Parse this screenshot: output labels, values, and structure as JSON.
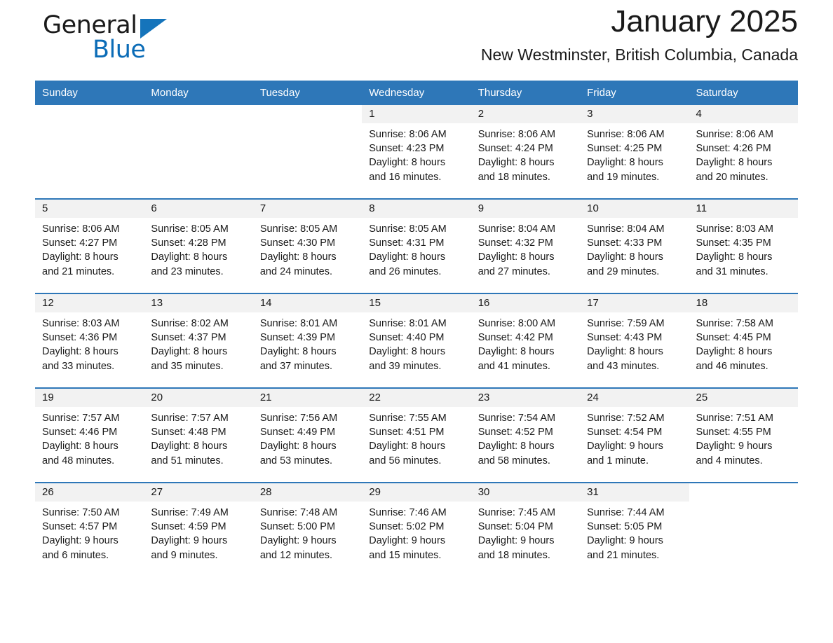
{
  "brand": {
    "word1": "General",
    "word2": "Blue",
    "accent_color": "#0b6cb7",
    "triangle_color": "#1574bb"
  },
  "header": {
    "month_title": "January 2025",
    "location": "New Westminster, British Columbia, Canada",
    "header_bg": "#2e77b8",
    "daynum_band_bg": "#f2f2f2"
  },
  "weekday_headers": [
    "Sunday",
    "Monday",
    "Tuesday",
    "Wednesday",
    "Thursday",
    "Friday",
    "Saturday"
  ],
  "weeks": [
    [
      {
        "day": "",
        "sunrise": "",
        "sunset": "",
        "daylight_line1": "",
        "daylight_line2": "",
        "blank": true
      },
      {
        "day": "",
        "sunrise": "",
        "sunset": "",
        "daylight_line1": "",
        "daylight_line2": "",
        "blank": true
      },
      {
        "day": "",
        "sunrise": "",
        "sunset": "",
        "daylight_line1": "",
        "daylight_line2": "",
        "blank": true
      },
      {
        "day": "1",
        "sunrise": "Sunrise: 8:06 AM",
        "sunset": "Sunset: 4:23 PM",
        "daylight_line1": "Daylight: 8 hours",
        "daylight_line2": "and 16 minutes."
      },
      {
        "day": "2",
        "sunrise": "Sunrise: 8:06 AM",
        "sunset": "Sunset: 4:24 PM",
        "daylight_line1": "Daylight: 8 hours",
        "daylight_line2": "and 18 minutes."
      },
      {
        "day": "3",
        "sunrise": "Sunrise: 8:06 AM",
        "sunset": "Sunset: 4:25 PM",
        "daylight_line1": "Daylight: 8 hours",
        "daylight_line2": "and 19 minutes."
      },
      {
        "day": "4",
        "sunrise": "Sunrise: 8:06 AM",
        "sunset": "Sunset: 4:26 PM",
        "daylight_line1": "Daylight: 8 hours",
        "daylight_line2": "and 20 minutes."
      }
    ],
    [
      {
        "day": "5",
        "sunrise": "Sunrise: 8:06 AM",
        "sunset": "Sunset: 4:27 PM",
        "daylight_line1": "Daylight: 8 hours",
        "daylight_line2": "and 21 minutes."
      },
      {
        "day": "6",
        "sunrise": "Sunrise: 8:05 AM",
        "sunset": "Sunset: 4:28 PM",
        "daylight_line1": "Daylight: 8 hours",
        "daylight_line2": "and 23 minutes."
      },
      {
        "day": "7",
        "sunrise": "Sunrise: 8:05 AM",
        "sunset": "Sunset: 4:30 PM",
        "daylight_line1": "Daylight: 8 hours",
        "daylight_line2": "and 24 minutes."
      },
      {
        "day": "8",
        "sunrise": "Sunrise: 8:05 AM",
        "sunset": "Sunset: 4:31 PM",
        "daylight_line1": "Daylight: 8 hours",
        "daylight_line2": "and 26 minutes."
      },
      {
        "day": "9",
        "sunrise": "Sunrise: 8:04 AM",
        "sunset": "Sunset: 4:32 PM",
        "daylight_line1": "Daylight: 8 hours",
        "daylight_line2": "and 27 minutes."
      },
      {
        "day": "10",
        "sunrise": "Sunrise: 8:04 AM",
        "sunset": "Sunset: 4:33 PM",
        "daylight_line1": "Daylight: 8 hours",
        "daylight_line2": "and 29 minutes."
      },
      {
        "day": "11",
        "sunrise": "Sunrise: 8:03 AM",
        "sunset": "Sunset: 4:35 PM",
        "daylight_line1": "Daylight: 8 hours",
        "daylight_line2": "and 31 minutes."
      }
    ],
    [
      {
        "day": "12",
        "sunrise": "Sunrise: 8:03 AM",
        "sunset": "Sunset: 4:36 PM",
        "daylight_line1": "Daylight: 8 hours",
        "daylight_line2": "and 33 minutes."
      },
      {
        "day": "13",
        "sunrise": "Sunrise: 8:02 AM",
        "sunset": "Sunset: 4:37 PM",
        "daylight_line1": "Daylight: 8 hours",
        "daylight_line2": "and 35 minutes."
      },
      {
        "day": "14",
        "sunrise": "Sunrise: 8:01 AM",
        "sunset": "Sunset: 4:39 PM",
        "daylight_line1": "Daylight: 8 hours",
        "daylight_line2": "and 37 minutes."
      },
      {
        "day": "15",
        "sunrise": "Sunrise: 8:01 AM",
        "sunset": "Sunset: 4:40 PM",
        "daylight_line1": "Daylight: 8 hours",
        "daylight_line2": "and 39 minutes."
      },
      {
        "day": "16",
        "sunrise": "Sunrise: 8:00 AM",
        "sunset": "Sunset: 4:42 PM",
        "daylight_line1": "Daylight: 8 hours",
        "daylight_line2": "and 41 minutes."
      },
      {
        "day": "17",
        "sunrise": "Sunrise: 7:59 AM",
        "sunset": "Sunset: 4:43 PM",
        "daylight_line1": "Daylight: 8 hours",
        "daylight_line2": "and 43 minutes."
      },
      {
        "day": "18",
        "sunrise": "Sunrise: 7:58 AM",
        "sunset": "Sunset: 4:45 PM",
        "daylight_line1": "Daylight: 8 hours",
        "daylight_line2": "and 46 minutes."
      }
    ],
    [
      {
        "day": "19",
        "sunrise": "Sunrise: 7:57 AM",
        "sunset": "Sunset: 4:46 PM",
        "daylight_line1": "Daylight: 8 hours",
        "daylight_line2": "and 48 minutes."
      },
      {
        "day": "20",
        "sunrise": "Sunrise: 7:57 AM",
        "sunset": "Sunset: 4:48 PM",
        "daylight_line1": "Daylight: 8 hours",
        "daylight_line2": "and 51 minutes."
      },
      {
        "day": "21",
        "sunrise": "Sunrise: 7:56 AM",
        "sunset": "Sunset: 4:49 PM",
        "daylight_line1": "Daylight: 8 hours",
        "daylight_line2": "and 53 minutes."
      },
      {
        "day": "22",
        "sunrise": "Sunrise: 7:55 AM",
        "sunset": "Sunset: 4:51 PM",
        "daylight_line1": "Daylight: 8 hours",
        "daylight_line2": "and 56 minutes."
      },
      {
        "day": "23",
        "sunrise": "Sunrise: 7:54 AM",
        "sunset": "Sunset: 4:52 PM",
        "daylight_line1": "Daylight: 8 hours",
        "daylight_line2": "and 58 minutes."
      },
      {
        "day": "24",
        "sunrise": "Sunrise: 7:52 AM",
        "sunset": "Sunset: 4:54 PM",
        "daylight_line1": "Daylight: 9 hours",
        "daylight_line2": "and 1 minute."
      },
      {
        "day": "25",
        "sunrise": "Sunrise: 7:51 AM",
        "sunset": "Sunset: 4:55 PM",
        "daylight_line1": "Daylight: 9 hours",
        "daylight_line2": "and 4 minutes."
      }
    ],
    [
      {
        "day": "26",
        "sunrise": "Sunrise: 7:50 AM",
        "sunset": "Sunset: 4:57 PM",
        "daylight_line1": "Daylight: 9 hours",
        "daylight_line2": "and 6 minutes."
      },
      {
        "day": "27",
        "sunrise": "Sunrise: 7:49 AM",
        "sunset": "Sunset: 4:59 PM",
        "daylight_line1": "Daylight: 9 hours",
        "daylight_line2": "and 9 minutes."
      },
      {
        "day": "28",
        "sunrise": "Sunrise: 7:48 AM",
        "sunset": "Sunset: 5:00 PM",
        "daylight_line1": "Daylight: 9 hours",
        "daylight_line2": "and 12 minutes."
      },
      {
        "day": "29",
        "sunrise": "Sunrise: 7:46 AM",
        "sunset": "Sunset: 5:02 PM",
        "daylight_line1": "Daylight: 9 hours",
        "daylight_line2": "and 15 minutes."
      },
      {
        "day": "30",
        "sunrise": "Sunrise: 7:45 AM",
        "sunset": "Sunset: 5:04 PM",
        "daylight_line1": "Daylight: 9 hours",
        "daylight_line2": "and 18 minutes."
      },
      {
        "day": "31",
        "sunrise": "Sunrise: 7:44 AM",
        "sunset": "Sunset: 5:05 PM",
        "daylight_line1": "Daylight: 9 hours",
        "daylight_line2": "and 21 minutes."
      },
      {
        "day": "",
        "sunrise": "",
        "sunset": "",
        "daylight_line1": "",
        "daylight_line2": "",
        "blank": true
      }
    ]
  ]
}
